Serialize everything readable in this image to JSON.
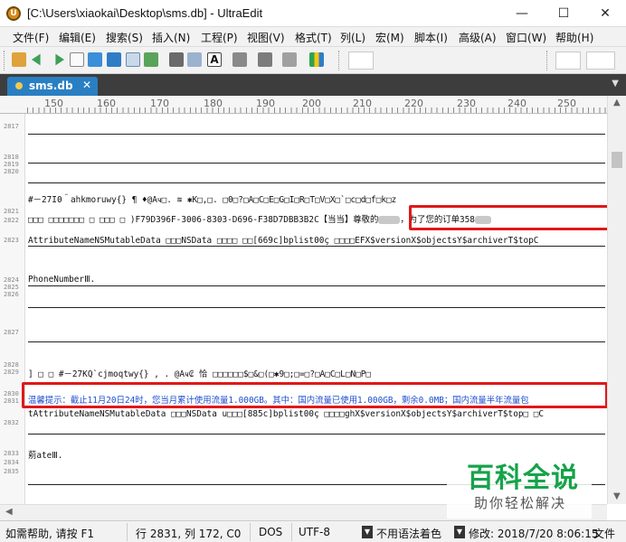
{
  "window": {
    "title": "[C:\\Users\\xiaokai\\Desktop\\sms.db] - UltraEdit",
    "minimize": "—",
    "maximize": "☐",
    "close": "✕"
  },
  "menu": [
    "文件(F)",
    "编辑(E)",
    "搜索(S)",
    "插入(N)",
    "工程(P)",
    "视图(V)",
    "格式(T)",
    "列(L)",
    "宏(M)",
    "脚本(I)",
    "高级(A)",
    "窗口(W)",
    "帮助(H)"
  ],
  "toolbar": {
    "bold_glyph": "A"
  },
  "tabs": [
    {
      "label": "sms.db",
      "close": "✕"
    }
  ],
  "tab_menu": "▼",
  "ruler": [
    "150",
    "160",
    "170",
    "180",
    "190",
    "200",
    "210",
    "220",
    "230",
    "240",
    "250"
  ],
  "gutter": [
    "2817",
    "2818",
    "2819",
    "2820",
    "2821",
    "2822",
    "2823",
    "2824",
    "2825",
    "2826",
    "2827",
    "2828",
    "2829",
    "2830",
    "2831",
    "2832",
    "2833",
    "2834",
    "2835"
  ],
  "lines": {
    "l2821": "#－27I0＾ahkmoruwy{}  ¶ ♦@Aҹ□. ≋ ✱K□,□. □0□?□A□C□E□G□I□R□T□V□X□`□c□d□f□k□z",
    "l2822a": "□□□ □□□□□□□ □  □□□ □  )F79D396F-3006-8303-D696-F38D7DBB3B2C",
    "l2822b": "【当当】尊敬的",
    "l2822c": "，为了您的订单358",
    "l2823": "AttributeNameNSMutableData □□□NSData □□□□ □□[669c]bplist00ç □□□□EFX$versionX$objectsY$archiverT$topC",
    "l2824": "PhoneNumberⅢ.",
    "l2829": "] □ □ #－27KQ`cjmoqtwy{}   , . @Aҹ₢ 恰  □□□□□□$□&□(□✱9□;□=□?□A□C□L□N□P□",
    "l2831": "温馨提示：截止11月20日24时，您当月累计使用流量1.000GB。其中：国内流量已使用1.000GB，剩余0.0MB；国内流量半年流量包",
    "l2832": "tAttributeNameNSMutableData □□□NSData u□□□[885c]bplist00ç □□□□ghX$versionX$objectsY$archiverT$top□ □C",
    "l2833": "莂ateⅢ."
  },
  "watermark": {
    "main": "百科全说",
    "sub": "助你轻松解决"
  },
  "status": {
    "help": "如需帮助, 请按 F1",
    "position": "行 2831, 列 172, C0",
    "line_ending": "DOS",
    "encoding": "UTF-8",
    "syntax": "不用语法着色",
    "modified": "修改: 2018/7/20 8:06:15",
    "extra": "文件"
  },
  "colors": {
    "accent": "#2a7fc2",
    "highlight": "#e01818",
    "link_text": "#1d4fd0",
    "watermark": "#16a34a"
  }
}
